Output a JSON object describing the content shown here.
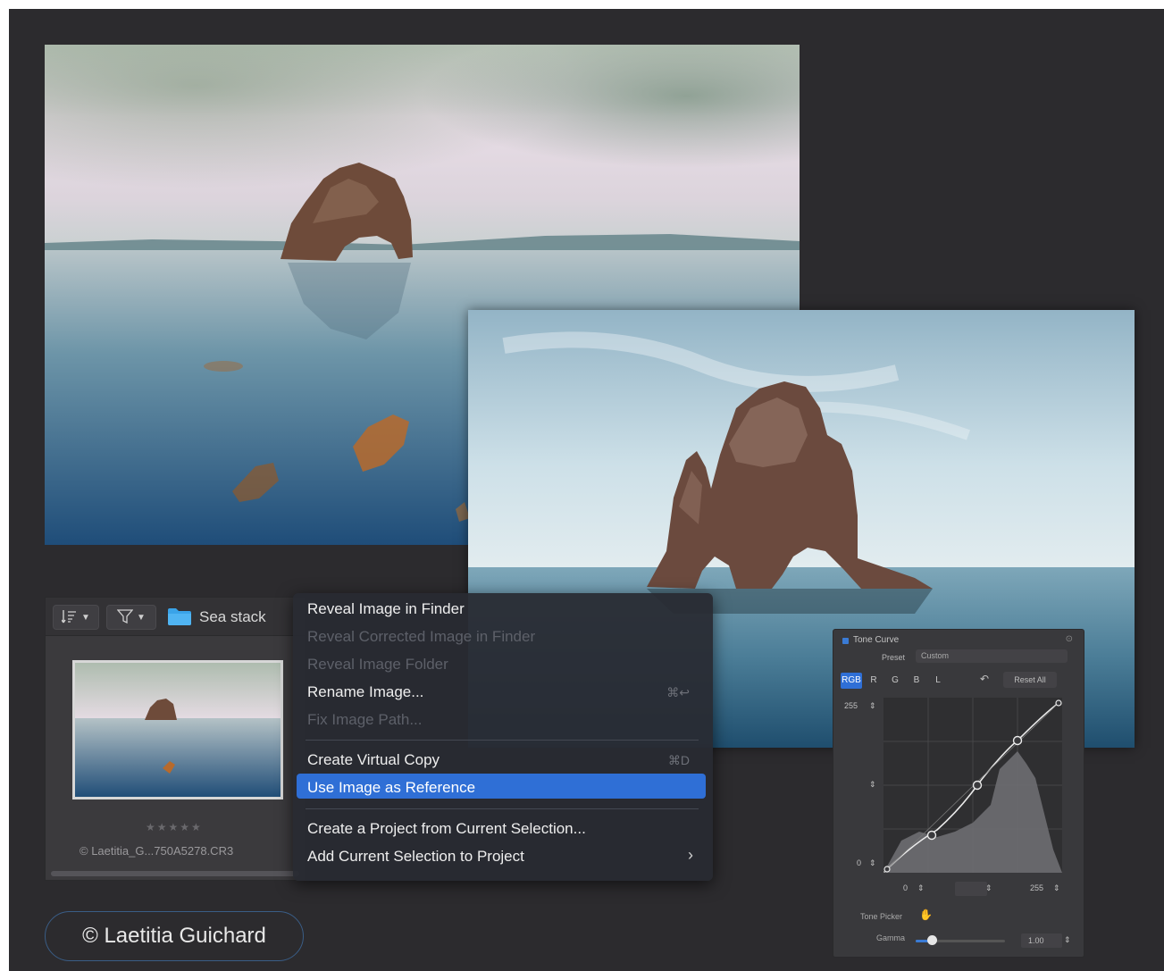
{
  "browser": {
    "folder_name": "Sea stack",
    "rating_stars": "★★★★★",
    "filename": "© Laetitia_G...750A5278.CR3",
    "icons": [
      "sort-icon",
      "filter-icon",
      "folder-icon",
      "chevron-down-icon"
    ]
  },
  "context_menu": {
    "items": [
      {
        "label": "Reveal Image in Finder",
        "enabled": true,
        "shortcut": ""
      },
      {
        "label": "Reveal Corrected Image in Finder",
        "enabled": false,
        "shortcut": ""
      },
      {
        "label": "Reveal Image Folder",
        "enabled": false,
        "shortcut": ""
      },
      {
        "label": "Rename Image...",
        "enabled": true,
        "shortcut": "⌘↩"
      },
      {
        "label": "Fix Image Path...",
        "enabled": false,
        "shortcut": ""
      },
      {
        "label": "Create Virtual Copy",
        "enabled": true,
        "shortcut": "⌘D"
      },
      {
        "label": "Use Image as Reference",
        "enabled": true,
        "highlighted": true,
        "shortcut": ""
      },
      {
        "label": "Create a Project from Current Selection...",
        "enabled": true,
        "shortcut": ""
      },
      {
        "label": "Add Current Selection to Project",
        "enabled": true,
        "shortcut": "",
        "submenu": true
      }
    ],
    "highlight_color": "#2f6fd6"
  },
  "tone_curve": {
    "title": "Tone Curve",
    "close": "⊙",
    "preset_label": "Preset",
    "preset_value": "Custom",
    "channels": [
      "RGB",
      "R",
      "G",
      "B",
      "L"
    ],
    "active_channel": "RGB",
    "reset_label": "Reset All",
    "undo_icon": "↶",
    "y_max": "255",
    "y_min": "0",
    "x_min": "0",
    "x_max": "255",
    "tone_picker_label": "Tone Picker",
    "gamma_label": "Gamma",
    "gamma_value": "1.00",
    "gamma_level": 0.18,
    "accent": "#3a7bd5"
  },
  "credit": "© Laetitia Guichard"
}
